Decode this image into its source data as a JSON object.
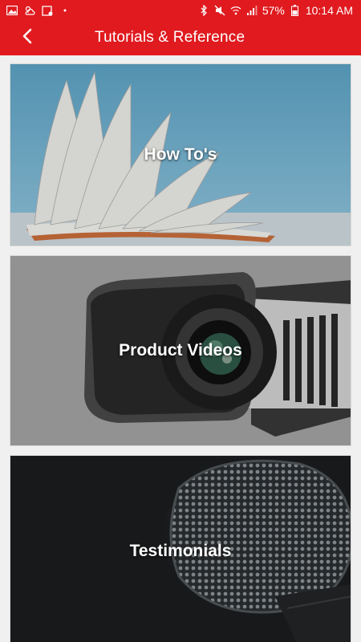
{
  "status_bar": {
    "battery": "57%",
    "time": "10:14 AM",
    "icons": [
      "gallery-icon",
      "weather-icon",
      "calendar-icon",
      "bluetooth-icon",
      "mute-icon",
      "wifi-icon",
      "signal-icon",
      "battery-icon"
    ]
  },
  "app_bar": {
    "title": "Tutorials & Reference",
    "back_icon": "back-arrow-icon"
  },
  "cards": [
    {
      "label": "How To's",
      "image": "open-book-photo"
    },
    {
      "label": "Product Videos",
      "image": "video-camera-photo"
    },
    {
      "label": "Testimonials",
      "image": "microphone-photo"
    }
  ],
  "colors": {
    "primary": "#e01a1f",
    "text_on_primary": "#ffffff",
    "background": "#f0f0f0"
  }
}
